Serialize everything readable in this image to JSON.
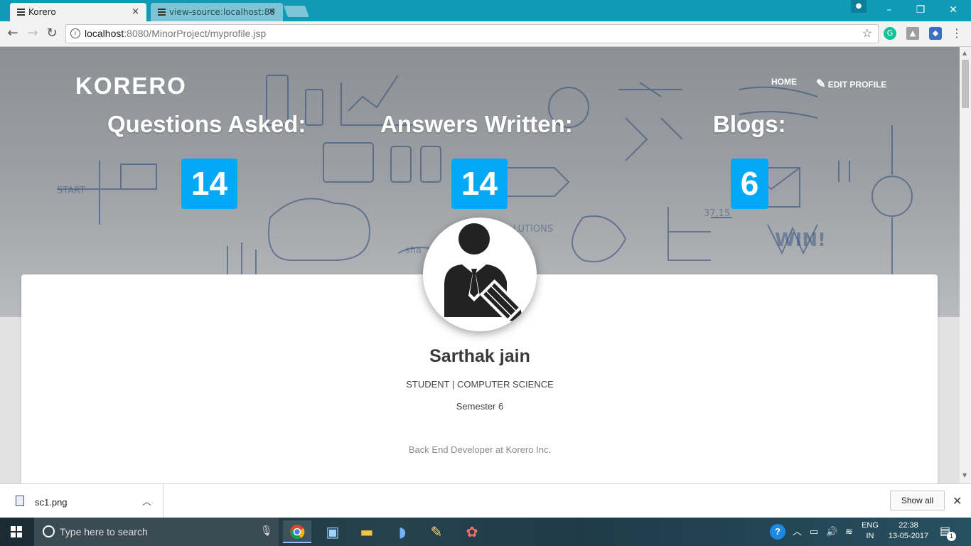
{
  "browser": {
    "tabs": [
      {
        "title": "Korero",
        "active": true
      },
      {
        "title": "view-source:localhost:80",
        "active": false
      }
    ],
    "close_glyph": "×",
    "address": {
      "host": "localhost",
      "path": ":8080/MinorProject/myprofile.jsp"
    },
    "window_controls": {
      "minimize": "–",
      "restore": "❐",
      "close": "✕"
    }
  },
  "page": {
    "logo_text": "KORERO",
    "nav": {
      "home": "HOME",
      "edit_profile": "EDIT PROFILE"
    },
    "stats": [
      {
        "label": "Questions Asked:",
        "value": "14"
      },
      {
        "label": "Answers Written:",
        "value": "14"
      },
      {
        "label": "Blogs:",
        "value": "6"
      }
    ],
    "profile": {
      "name": "Sarthak jain",
      "role": "STUDENT | COMPUTER SCIENCE",
      "semester": "Semester 6",
      "bio": "Back End Developer at Korero Inc."
    },
    "accent_color": "#03a9f4"
  },
  "downloads": {
    "file": "sc1.png",
    "show_all": "Show all"
  },
  "taskbar": {
    "search_placeholder": "Type here to search",
    "lang_top": "ENG",
    "lang_bottom": "IN",
    "time": "22:38",
    "date": "13-05-2017",
    "notification_count": "1"
  }
}
